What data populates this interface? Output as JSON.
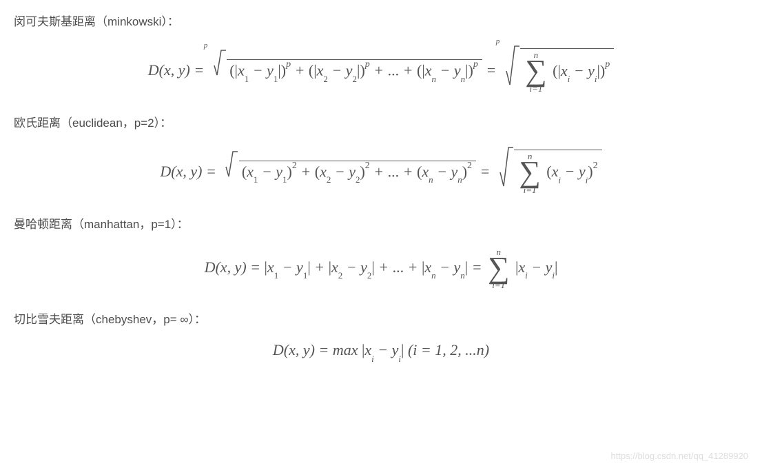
{
  "sections": {
    "minkowski": {
      "heading": "闵可夫斯基距离（minkowski）："
    },
    "euclidean": {
      "heading": "欧氏距离（euclidean，p=2）："
    },
    "manhattan": {
      "heading": "曼哈顿距离（manhattan，p=1）："
    },
    "chebyshev": {
      "heading": "切比雪夫距离（chebyshev，p= ∞）："
    }
  },
  "formulas": {
    "minkowski_tex": "D(x,y) = \\sqrt[p]{(|x_1 - y_1|)^p + (|x_2 - y_2|)^p + ... + (|x_n - y_n|)^p} = \\sqrt[p]{\\sum_{i=1}^{n}(|x_i - y_i|)^p}",
    "euclidean_tex": "D(x,y) = \\sqrt{(x_1 - y_1)^2 + (x_2 - y_2)^2 + ... + (x_n - y_n)^2} = \\sqrt{\\sum_{i=1}^{n}(x_i - y_i)^2}",
    "manhattan_tex": "D(x,y) = |x_1 - y_1| + |x_2 - y_2| + ... + |x_n - y_n| = \\sum_{i=1}^{n}|x_i - y_i|",
    "chebyshev_tex": "D(x,y) = max|x_i - y_i| (i = 1,2,...n)"
  },
  "sym": {
    "D": "D",
    "x": "x",
    "y": "y",
    "p": "p",
    "n": "n",
    "i": "i",
    "one": "1",
    "two": "2",
    "lp": "(",
    "rp": ")",
    "comma": ",",
    "eq": " = ",
    "minus": " − ",
    "plus": " + ",
    "dots": " ... ",
    "bar": "|",
    "sigma": "∑",
    "i1": "i=1",
    "max": "max",
    "iset": "(i = 1, 2, ...n)",
    "Dxy_eq": "D(x, y) = "
  },
  "watermark": "https://blog.csdn.net/qq_41289920"
}
